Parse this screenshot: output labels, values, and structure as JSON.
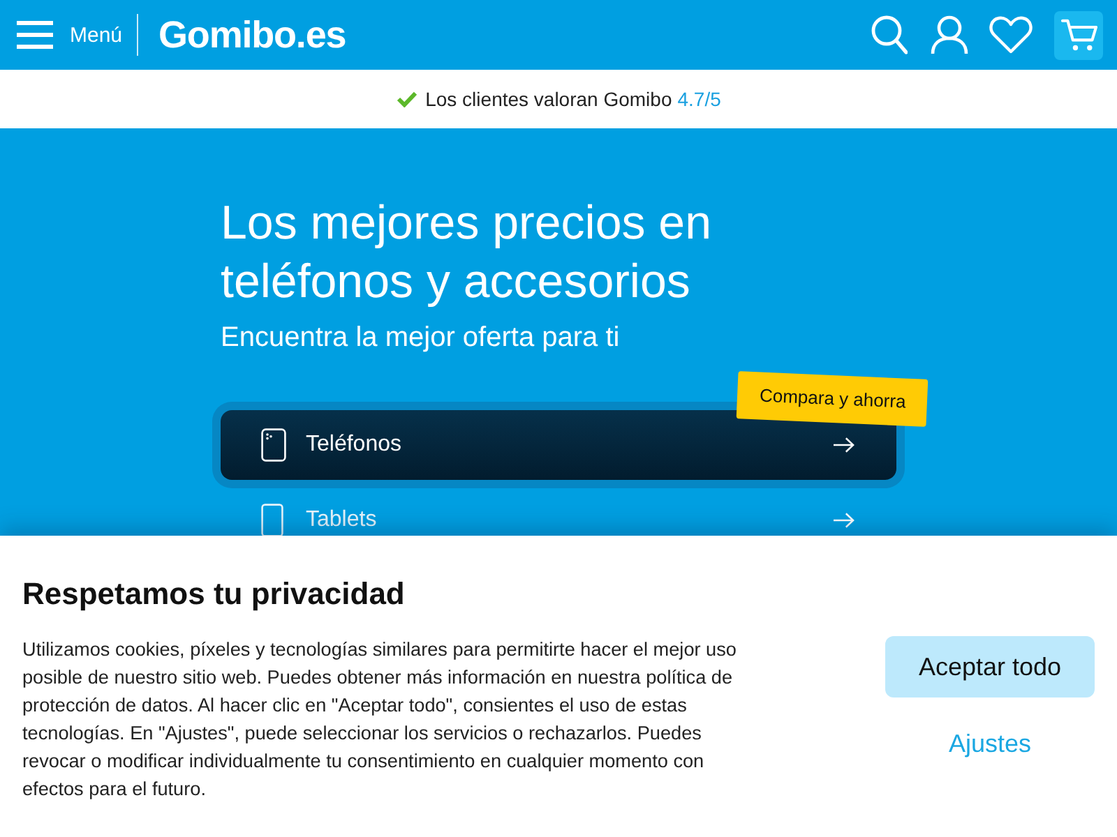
{
  "header": {
    "menu_label": "Menú",
    "logo": "Gomibo.es"
  },
  "trust_bar": {
    "text": "Los clientes valoran Gomibo",
    "rating": "4.7/5"
  },
  "hero": {
    "title": "Los mejores precios en teléfonos y accesorios",
    "subtitle": "Encuentra la mejor oferta para ti",
    "promo_badge": "Compara y ahorra",
    "categories": [
      {
        "label": "Teléfonos",
        "kind": "phone",
        "selected": true
      },
      {
        "label": "Tablets",
        "kind": "tablet",
        "selected": false
      }
    ]
  },
  "cookie_banner": {
    "title": "Respetamos tu privacidad",
    "body": "Utilizamos cookies, píxeles y tecnologías similares para permitirte hacer el mejor uso posible de nuestro sitio web. Puedes obtener más información en nuestra política de protección de datos. Al hacer clic en \"Aceptar todo\", consientes el uso de estas tecnologías. En \"Ajustes\", puede seleccionar los servicios o rechazarlos. Puedes revocar o modificar individualmente tu consentimiento en cualquier momento con efectos para el futuro.",
    "buttons": [
      {
        "label": "Aceptar todo",
        "kind": "primary"
      },
      {
        "label": "Ajustes",
        "kind": "link"
      }
    ]
  }
}
